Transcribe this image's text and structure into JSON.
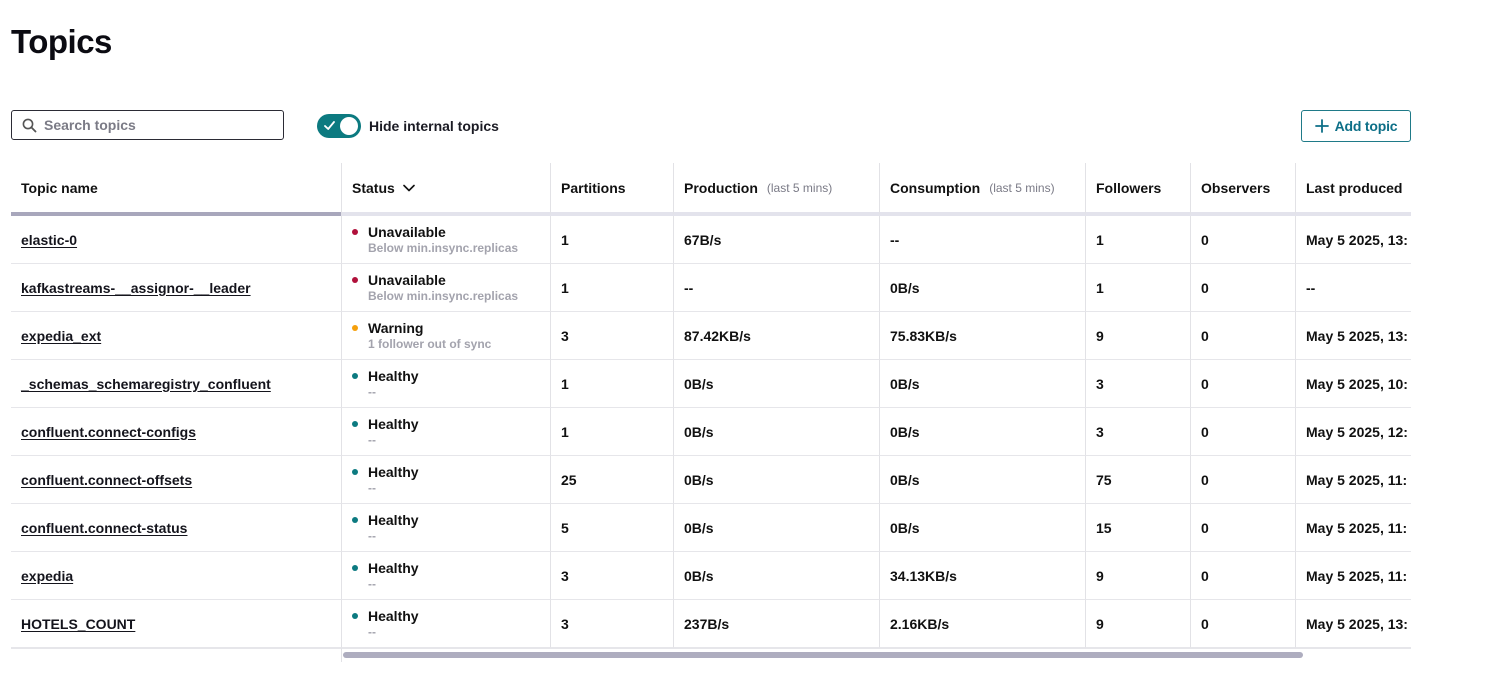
{
  "page": {
    "title": "Topics"
  },
  "toolbar": {
    "search_placeholder": "Search topics",
    "search_value": "",
    "hide_internal_label": "Hide internal topics",
    "hide_internal_on": true,
    "add_topic_label": "Add topic"
  },
  "colors": {
    "accent": "#0c7a80",
    "unavailable": "#b0103a",
    "warning": "#f5a00c",
    "healthy": "#0c7a80"
  },
  "table": {
    "columns": [
      {
        "label": "Topic name",
        "sub": ""
      },
      {
        "label": "Status",
        "sub": "",
        "icon": "chevron-down-icon"
      },
      {
        "label": "Partitions",
        "sub": ""
      },
      {
        "label": "Production",
        "sub": "(last 5 mins)"
      },
      {
        "label": "Consumption",
        "sub": "(last 5 mins)"
      },
      {
        "label": "Followers",
        "sub": ""
      },
      {
        "label": "Observers",
        "sub": ""
      },
      {
        "label": "Last produced",
        "sub": ""
      }
    ],
    "rows": [
      {
        "name": "elastic-0",
        "status": "Unavailable",
        "status_kind": "unavailable",
        "status_detail": "Below min.insync.replicas",
        "partitions": "1",
        "production": "67B/s",
        "consumption": "--",
        "followers": "1",
        "observers": "0",
        "last_produced": "May 5 2025, 13:"
      },
      {
        "name": "kafkastreams-__assignor-__leader",
        "status": "Unavailable",
        "status_kind": "unavailable",
        "status_detail": "Below min.insync.replicas",
        "partitions": "1",
        "production": "--",
        "consumption": "0B/s",
        "followers": "1",
        "observers": "0",
        "last_produced": "--"
      },
      {
        "name": "expedia_ext",
        "status": "Warning",
        "status_kind": "warning",
        "status_detail": "1 follower out of sync",
        "partitions": "3",
        "production": "87.42KB/s",
        "consumption": "75.83KB/s",
        "followers": "9",
        "observers": "0",
        "last_produced": "May 5 2025, 13:"
      },
      {
        "name": "_schemas_schemaregistry_confluent",
        "status": "Healthy",
        "status_kind": "healthy",
        "status_detail": "--",
        "partitions": "1",
        "production": "0B/s",
        "consumption": "0B/s",
        "followers": "3",
        "observers": "0",
        "last_produced": "May 5 2025, 10:"
      },
      {
        "name": "confluent.connect-configs",
        "status": "Healthy",
        "status_kind": "healthy",
        "status_detail": "--",
        "partitions": "1",
        "production": "0B/s",
        "consumption": "0B/s",
        "followers": "3",
        "observers": "0",
        "last_produced": "May 5 2025, 12:"
      },
      {
        "name": "confluent.connect-offsets",
        "status": "Healthy",
        "status_kind": "healthy",
        "status_detail": "--",
        "partitions": "25",
        "production": "0B/s",
        "consumption": "0B/s",
        "followers": "75",
        "observers": "0",
        "last_produced": "May 5 2025, 11:"
      },
      {
        "name": "confluent.connect-status",
        "status": "Healthy",
        "status_kind": "healthy",
        "status_detail": "--",
        "partitions": "5",
        "production": "0B/s",
        "consumption": "0B/s",
        "followers": "15",
        "observers": "0",
        "last_produced": "May 5 2025, 11:"
      },
      {
        "name": "expedia",
        "status": "Healthy",
        "status_kind": "healthy",
        "status_detail": "--",
        "partitions": "3",
        "production": "0B/s",
        "consumption": "34.13KB/s",
        "followers": "9",
        "observers": "0",
        "last_produced": "May 5 2025, 11:"
      },
      {
        "name": "HOTELS_COUNT",
        "status": "Healthy",
        "status_kind": "healthy",
        "status_detail": "--",
        "partitions": "3",
        "production": "237B/s",
        "consumption": "2.16KB/s",
        "followers": "9",
        "observers": "0",
        "last_produced": "May 5 2025, 13:"
      }
    ]
  }
}
